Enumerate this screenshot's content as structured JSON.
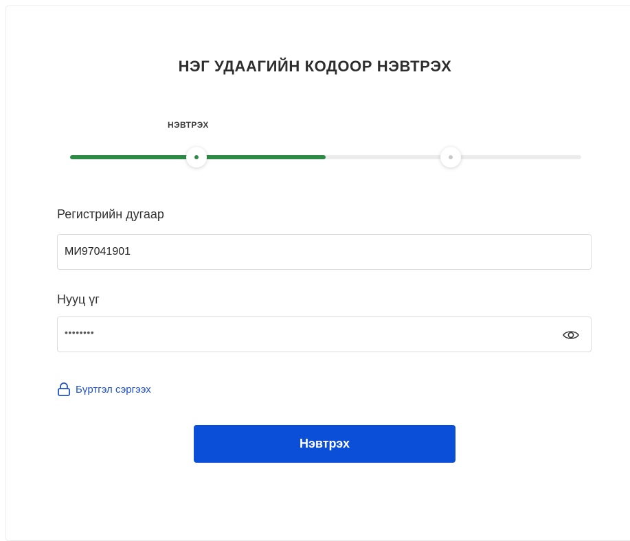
{
  "form": {
    "title": "НЭГ УДААГИЙН КОДООР НЭВТРЭХ",
    "stepper": {
      "current_step_label": "НЭВТРЭХ",
      "progress_percent": 50,
      "active_color": "#2e8b46",
      "inactive_color": "#ececec"
    },
    "register_field": {
      "label": "Регистрийн дугаар",
      "value": "МИ97041901"
    },
    "password_field": {
      "label": "Нууц үг",
      "value": "••••••••",
      "toggle_icon": "eye-icon"
    },
    "recover_link": {
      "icon": "lock-icon",
      "label": "Бүртгэл сэргээх",
      "color": "#1e4fcf"
    },
    "submit_button": {
      "label": "Нэвтрэх",
      "color": "#0b4fd9"
    }
  }
}
